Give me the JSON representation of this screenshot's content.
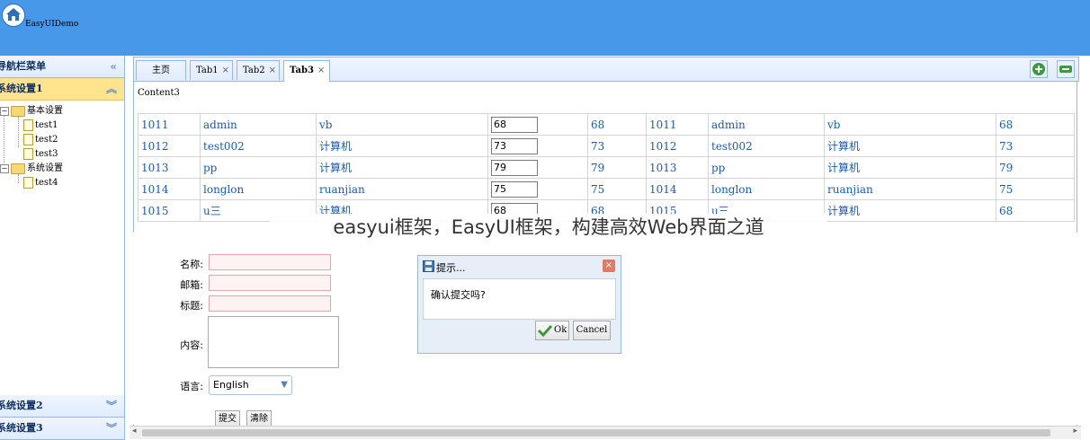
{
  "header": {
    "title": "EasyUIDemo"
  },
  "west": {
    "title": "导航栏菜单",
    "panels": [
      {
        "label": "系统设置1"
      },
      {
        "label": "系统设置2"
      },
      {
        "label": "系统设置3"
      }
    ],
    "tree": [
      {
        "label": "基本设置"
      },
      {
        "label": "test1"
      },
      {
        "label": "test2"
      },
      {
        "label": "test3"
      },
      {
        "label": "系统设置"
      },
      {
        "label": "test4"
      }
    ]
  },
  "tabs": [
    {
      "label": "主页"
    },
    {
      "label": "Tab1"
    },
    {
      "label": "Tab2"
    },
    {
      "label": "Tab3"
    }
  ],
  "content_label": "Content3",
  "grid": {
    "rows": [
      [
        "1011",
        "admin",
        "vb",
        "68",
        "68",
        "1011",
        "admin",
        "vb",
        "68"
      ],
      [
        "1012",
        "test002",
        "计算机",
        "73",
        "73",
        "1012",
        "test002",
        "计算机",
        "73"
      ],
      [
        "1013",
        "pp",
        "计算机",
        "79",
        "79",
        "1013",
        "pp",
        "计算机",
        "79"
      ],
      [
        "1014",
        "longlon",
        "ruanjian",
        "75",
        "75",
        "1014",
        "longlon",
        "ruanjian",
        "75"
      ],
      [
        "1015",
        "u三",
        "计算机",
        "68",
        "68",
        "1015",
        "u三",
        "计算机",
        "68"
      ]
    ]
  },
  "caption": "easyui框架，EasyUI框架，构建高效Web界面之道",
  "form": {
    "name_label": "名称:",
    "email_label": "邮箱:",
    "title_label": "标题:",
    "content_label": "内容:",
    "language_label": "语言:",
    "language_value": "English",
    "submit_label": "提交",
    "clear_label": "清除"
  },
  "dialog": {
    "title": "提示...",
    "message": "确认提交吗?",
    "ok_label": "Ok",
    "cancel_label": "Cancel"
  }
}
